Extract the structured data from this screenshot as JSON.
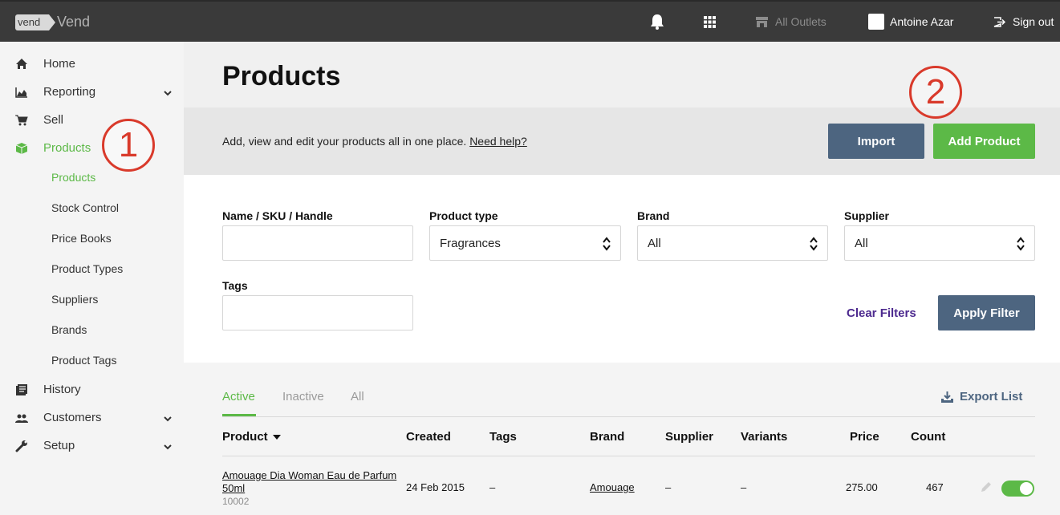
{
  "topbar": {
    "logo_text": "vend",
    "app_name": "Vend",
    "outlets_label": "All Outlets",
    "user_name": "Antoine Azar",
    "signout_label": "Sign out"
  },
  "sidebar": {
    "items": [
      {
        "label": "Home",
        "icon": "home-icon"
      },
      {
        "label": "Reporting",
        "icon": "chart-icon"
      },
      {
        "label": "Sell",
        "icon": "cart-icon"
      },
      {
        "label": "Products",
        "icon": "box-icon"
      },
      {
        "label": "History",
        "icon": "history-icon"
      },
      {
        "label": "Customers",
        "icon": "users-icon"
      },
      {
        "label": "Setup",
        "icon": "wrench-icon"
      }
    ],
    "sub_items": [
      "Products",
      "Stock Control",
      "Price Books",
      "Product Types",
      "Suppliers",
      "Brands",
      "Product Tags"
    ]
  },
  "main": {
    "title": "Products",
    "banner_text": "Add, view and edit your products all in one place. ",
    "banner_link": "Need help?",
    "import_label": "Import",
    "add_product_label": "Add Product"
  },
  "filters": {
    "name_label": "Name / SKU / Handle",
    "name_value": "",
    "type_label": "Product type",
    "type_value": "Fragrances",
    "brand_label": "Brand",
    "brand_value": "All",
    "supplier_label": "Supplier",
    "supplier_value": "All",
    "tags_label": "Tags",
    "tags_value": "",
    "clear_label": "Clear Filters",
    "apply_label": "Apply Filter"
  },
  "list": {
    "tabs": [
      "Active",
      "Inactive",
      "All"
    ],
    "export_label": "Export List",
    "columns": [
      "Product",
      "Created",
      "Tags",
      "Brand",
      "Supplier",
      "Variants",
      "Price",
      "Count"
    ],
    "rows": [
      {
        "product_line1": "Amouage Dia Woman Eau de Parfum",
        "product_line2": "50ml",
        "sku": "10002",
        "created": "24 Feb 2015",
        "tags": "–",
        "brand": "Amouage",
        "supplier": "–",
        "variants": "–",
        "price": "275.00",
        "count": "467"
      }
    ]
  },
  "annotations": [
    "1",
    "2"
  ],
  "colors": {
    "accent_green": "#5cb947",
    "slate_button": "#4d6580",
    "callout_red": "#d93a2b",
    "topbar": "#3a3a3a"
  }
}
